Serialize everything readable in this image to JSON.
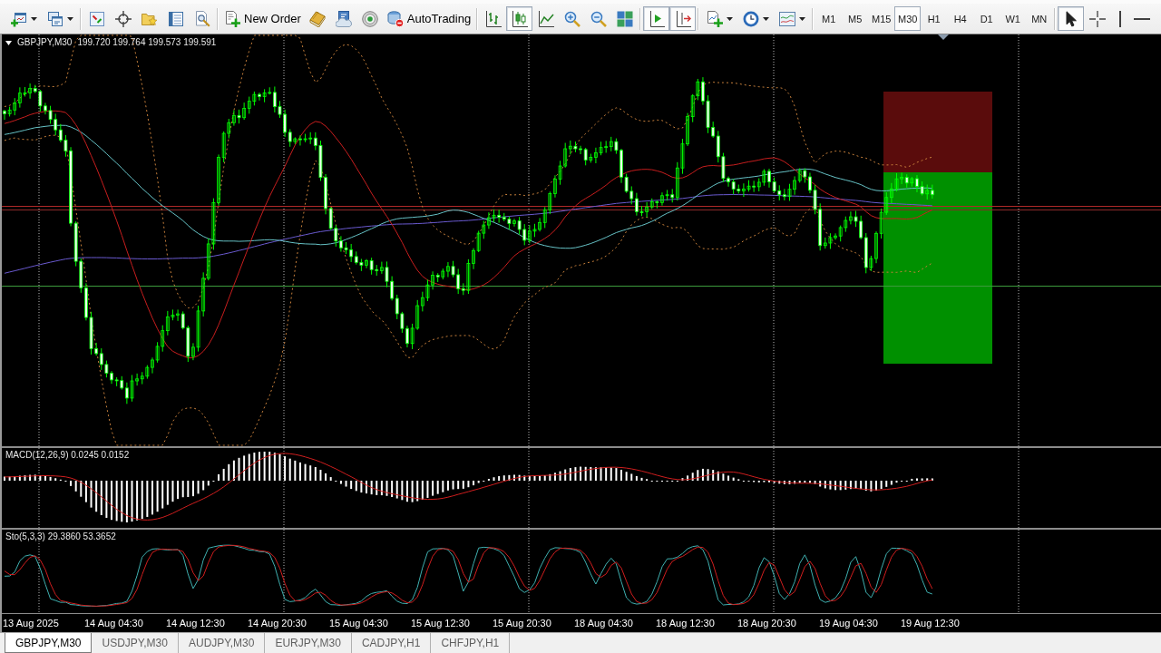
{
  "toolbar": [
    {
      "kind": "buttons",
      "items": [
        {
          "kind": "menu",
          "pressed": false
        },
        {
          "kind": "menu",
          "pressed": false
        }
      ]
    },
    {
      "kind": "buttons",
      "items": [
        {
          "kind": "icon",
          "pressed": false
        },
        {
          "kind": "icon",
          "pressed": false
        },
        {
          "kind": "icon",
          "pressed": false
        },
        {
          "kind": "icon",
          "pressed": false
        },
        {
          "kind": "icon",
          "pressed": false
        }
      ]
    },
    {
      "kind": "buttons",
      "items": [
        {
          "kind": "labeled",
          "label": "New Order",
          "pressed": false
        },
        {
          "kind": "icon",
          "pressed": false
        },
        {
          "kind": "icon",
          "pressed": false
        },
        {
          "kind": "icon",
          "pressed": false
        },
        {
          "kind": "labeled",
          "label": "AutoTrading",
          "pressed": false
        }
      ]
    },
    {
      "kind": "buttons",
      "items": [
        {
          "kind": "icon",
          "pressed": false
        },
        {
          "kind": "icon",
          "pressed": true
        },
        {
          "kind": "icon",
          "pressed": false
        },
        {
          "kind": "icon",
          "pressed": false
        },
        {
          "kind": "icon",
          "pressed": false
        },
        {
          "kind": "icon",
          "pressed": false
        }
      ]
    },
    {
      "kind": "buttons",
      "items": [
        {
          "kind": "icon",
          "pressed": true
        },
        {
          "kind": "icon",
          "pressed": true
        }
      ]
    },
    {
      "kind": "buttons",
      "items": [
        {
          "kind": "menu",
          "pressed": false
        },
        {
          "kind": "menu",
          "pressed": false
        },
        {
          "kind": "menu",
          "pressed": false
        }
      ]
    },
    {
      "kind": "timeframes",
      "items": [
        {
          "label": "M1",
          "selected": false
        },
        {
          "label": "M5",
          "selected": false
        },
        {
          "label": "M15",
          "selected": false
        },
        {
          "label": "M30",
          "selected": true
        },
        {
          "label": "H1",
          "selected": false
        },
        {
          "label": "H4",
          "selected": false
        },
        {
          "label": "D1",
          "selected": false
        },
        {
          "label": "W1",
          "selected": false
        },
        {
          "label": "MN",
          "selected": false
        }
      ]
    },
    {
      "kind": "buttons",
      "items": [
        {
          "kind": "icon",
          "pressed": true
        },
        {
          "kind": "icon",
          "pressed": false
        },
        {
          "kind": "icon",
          "pressed": false
        },
        {
          "kind": "icon",
          "pressed": false
        }
      ]
    }
  ],
  "chart": {
    "symbol": "GBPJPY,M30",
    "quote": "199.720 199.764 199.573 199.591",
    "macd_label": "MACD(12,26,9) 0.0245 0.0152",
    "stochastic_label": "Sto(5,3,3) 29.3860 53.3652",
    "time_axis": [
      "13 Aug 2025",
      "14 Aug 04:30",
      "14 Aug 12:30",
      "14 Aug 20:30",
      "15 Aug 04:30",
      "15 Aug 12:30",
      "15 Aug 20:30",
      "18 Aug 04:30",
      "18 Aug 12:30",
      "18 Aug 20:30",
      "19 Aug 04:30",
      "19 Aug 12:30"
    ]
  },
  "tabs": [
    {
      "label": "GBPJPY,M30",
      "selected": true
    },
    {
      "label": "USDJPY,M30",
      "selected": false
    },
    {
      "label": "AUDJPY,M30",
      "selected": false
    },
    {
      "label": "EURJPY,M30",
      "selected": false
    },
    {
      "label": "CADJPY,H1",
      "selected": false
    },
    {
      "label": "CHFJPY,H1",
      "selected": false
    }
  ]
}
